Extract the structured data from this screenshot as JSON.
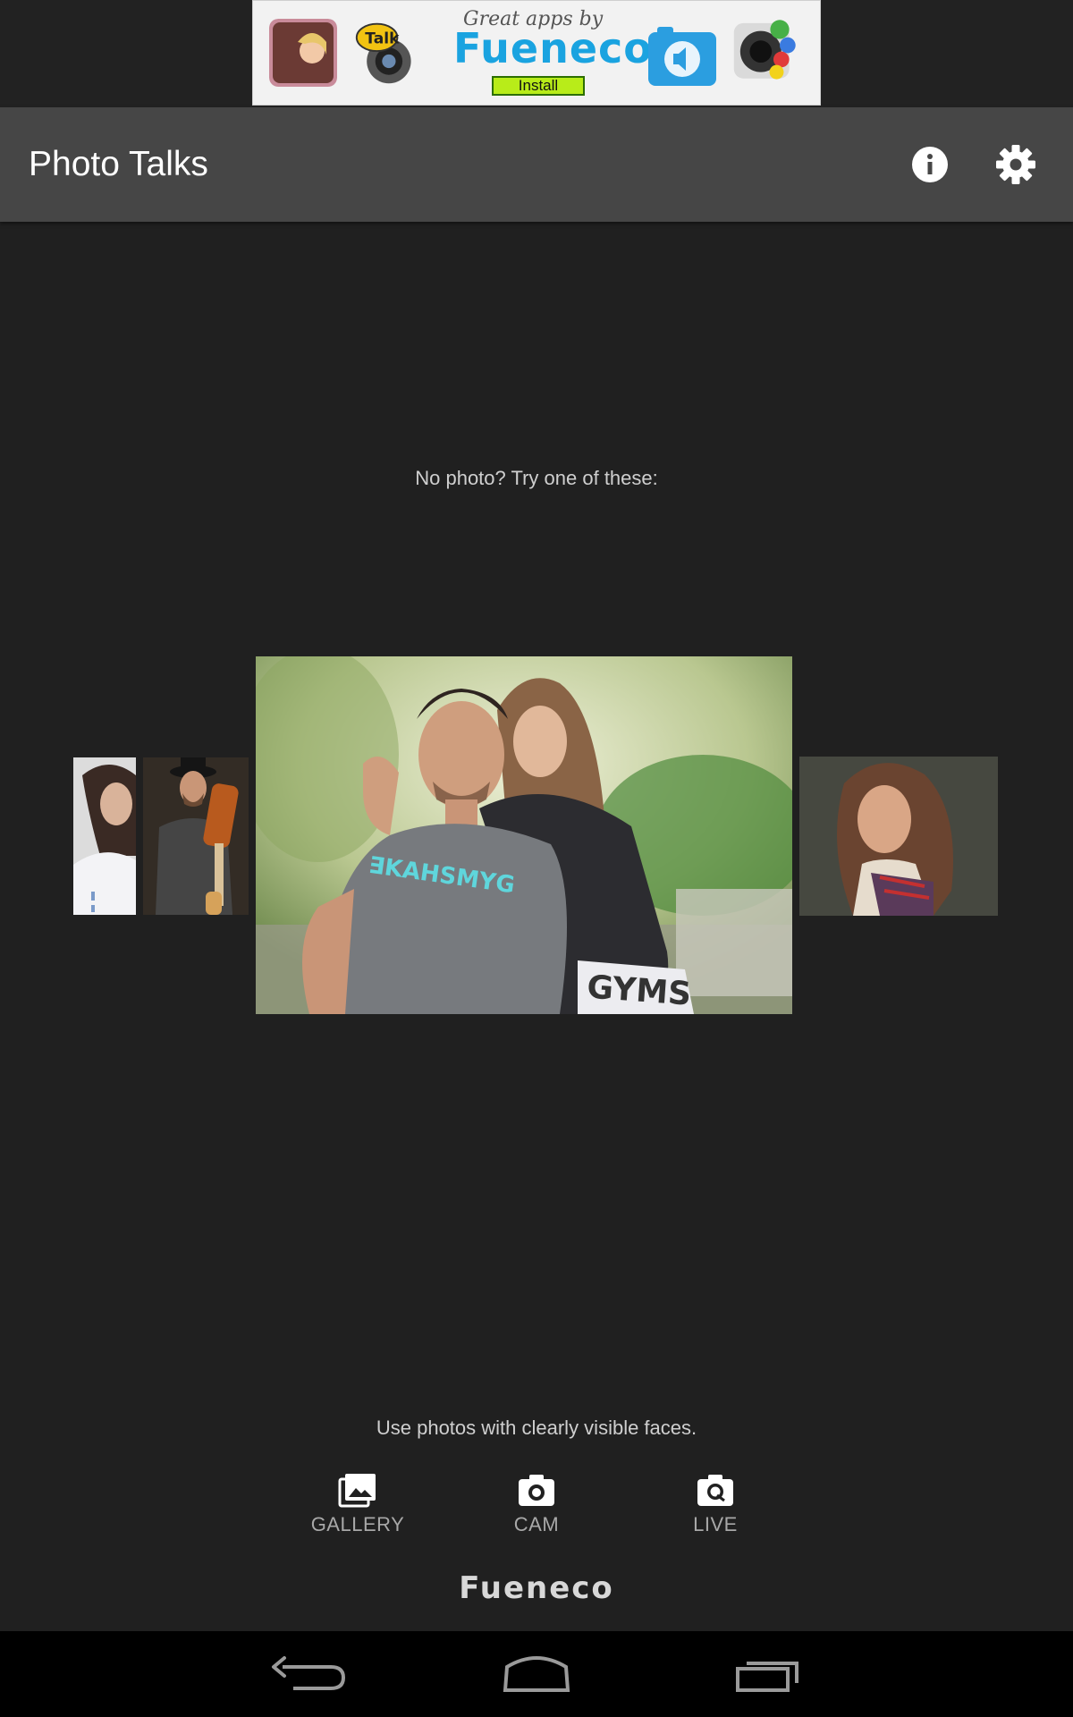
{
  "ad": {
    "headline": "Great apps by",
    "brand": "Fueneco",
    "install_label": "Install"
  },
  "app_bar": {
    "title": "Photo Talks",
    "icons": [
      "info-icon",
      "settings-icon"
    ]
  },
  "main": {
    "prompt": "No photo? Try one of these:",
    "sample_photos": [
      {
        "name": "woman-white-dress",
        "selected": false
      },
      {
        "name": "man-hat-guitar",
        "selected": false
      },
      {
        "name": "couple-gymshark",
        "selected": true
      },
      {
        "name": "woman-long-hair",
        "selected": false
      }
    ],
    "tip": "Use photos with clearly visible faces."
  },
  "actions": [
    {
      "label": "GALLERY",
      "icon": "gallery-icon"
    },
    {
      "label": "CAM",
      "icon": "camera-icon"
    },
    {
      "label": "LIVE",
      "icon": "live-camera-icon"
    }
  ],
  "footer": {
    "brand": "Fueneco"
  },
  "nav": [
    "back-icon",
    "home-icon",
    "recents-icon"
  ],
  "colors": {
    "background": "#202020",
    "app_bar": "#464646",
    "ad_brand": "#1aa3e0"
  }
}
